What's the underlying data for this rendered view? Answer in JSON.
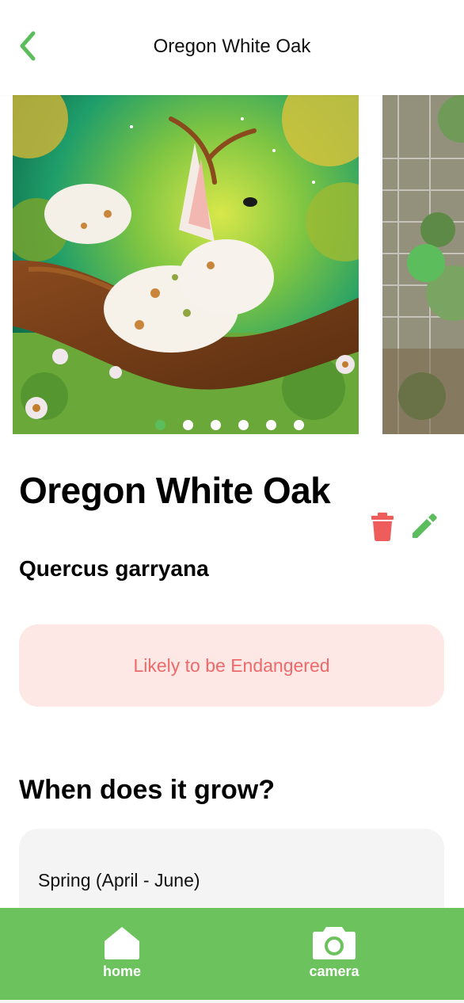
{
  "header": {
    "title": "Oregon White Oak"
  },
  "carousel": {
    "slide_count": 6,
    "active_index": 0
  },
  "plant": {
    "name": "Oregon White Oak",
    "scientific_name": "Quercus garryana"
  },
  "status": {
    "label": "Likely to be Endangered"
  },
  "grow_section": {
    "title": "When does it grow?",
    "seasons": [
      "Spring (April - June)"
    ]
  },
  "nav": {
    "items": [
      {
        "label": "home",
        "icon": "home-icon"
      },
      {
        "label": "camera",
        "icon": "camera-icon"
      }
    ]
  },
  "colors": {
    "accent": "#5cbd5c",
    "nav_bg": "#6cc25d",
    "danger": "#ee5c5c",
    "status_bg": "#fde8e6",
    "status_text": "#ee6a6a"
  }
}
